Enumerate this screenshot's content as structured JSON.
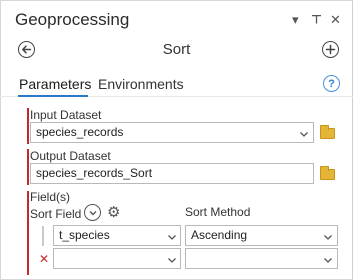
{
  "pane": {
    "title": "Geoprocessing",
    "controls": {
      "menu": "▾",
      "pin": "⊥",
      "close": "✕"
    }
  },
  "tool": {
    "title": "Sort"
  },
  "tabs": [
    {
      "label": "Parameters",
      "active": true
    },
    {
      "label": "Environments",
      "active": false
    }
  ],
  "help": {
    "glyph": "?"
  },
  "input_dataset": {
    "label": "Input Dataset",
    "value": "species_records"
  },
  "output_dataset": {
    "label": "Output Dataset",
    "value": "species_records_Sort"
  },
  "fields": {
    "label": "Field(s)",
    "sort_field_header": "Sort Field",
    "sort_method_header": "Sort Method",
    "rows": [
      {
        "field": "t_species",
        "method": "Ascending"
      },
      {
        "field": "",
        "method": ""
      }
    ]
  },
  "colors": {
    "accent": "#2a78c7",
    "required": "#c62828",
    "folder": "#e5b636"
  }
}
